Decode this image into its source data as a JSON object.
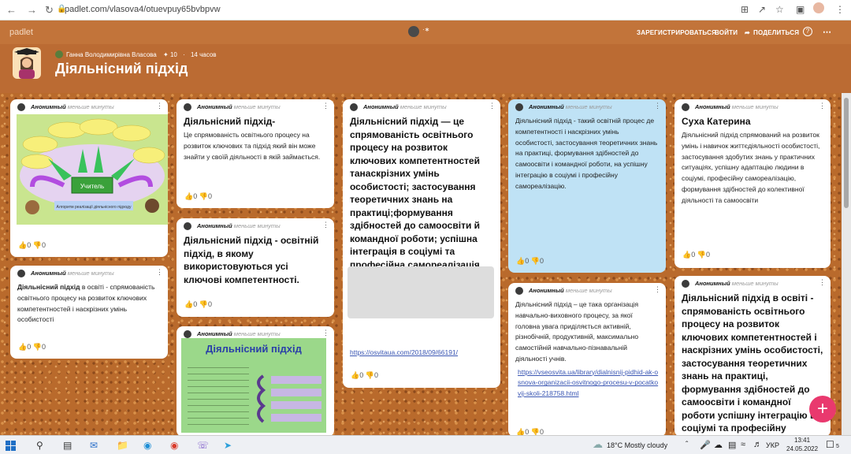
{
  "browser": {
    "url": "padlet.com/vlasova4/otuevpuy65bvbpvw"
  },
  "topbar": {
    "logo": "padlet",
    "register": "ЗАРЕГИСТРИРОВАТЬСЯ",
    "login": "ВОЙТИ",
    "share": "ПОДЕЛИТЬСЯ"
  },
  "header": {
    "author": "Ганна Володимирівна Власова",
    "likes": "10",
    "age": "14 часов",
    "title": "Діяльнісний підхід"
  },
  "card_meta": {
    "author": "Анонимный",
    "time": "меньше минуты",
    "zero": "0"
  },
  "cards": {
    "c1": {
      "img_title": "Учитель",
      "img_caption": "Алгоритм реалізації діяльнісного підходу"
    },
    "c2": {
      "bold": "Діяльнісний підхід",
      "text": " в освіті - спрямованість освітнього процесу на розвиток ключових компетентностей і наскрізних умінь особистості"
    },
    "c3": {
      "title": "Діяльнісний підхід-",
      "body": "Це спрямованість освітнього процесу на розвиток ключових та підхід який він може знайти у своїй діяльності в якій займається."
    },
    "c4": {
      "body": "Діяльнісний підхід - освітній підхід, в якому використовуються усі ключові компетентності."
    },
    "c5": {
      "img_title": "Діяльнісний підхід"
    },
    "c6": {
      "body": "Діяльнісний підхід — це спрямованість освітнього процесу на розвиток ключових компетентностей танаскрізних умінь особистості; застосування теоретичних знань на практиці;формування здібностей до самоосвіти й командної роботи; успішна інтеграція в соціумі та професійна самореалізація.",
      "link": "https://osvitaua.com/2018/09/66191/"
    },
    "c7": {
      "body": "Діяльнісний підхід - такий освітній процес де компетентності і наскрізних умінь особистості, застосування теоретичних знань на практиці, формування здібностей до самоосвіти і командної роботи, на успішну інтеграцію в соціумі і професійну самореалізацію."
    },
    "c8": {
      "body": "Діяльнісний підхід – це така організація навчально-виховного процесу, за якої головна увага приділяється активній, різнобічній, продуктивній, максимально самостійній навчально-пізнавальній діяльності учнів.",
      "link": "https://vseosvita.ua/library/dialnisnij-pidhid-ak-osnova-organizacii-osvitnogo-procesu-v-pocatkovij-skoli-218758.html"
    },
    "c9": {
      "title": "Суха Катерина",
      "body": "Діяльнісний підхід спрямований на розвиток умінь і навичок життєдіяльності особистості, застосування здобутих знань у практичних ситуаціях, успішну адаптацію людини в соціумі, професійну самореалізацію, формування здібностей до колективної діяльності та самоосвіти"
    },
    "c10": {
      "body": "Діяльнісний підхід в освіті - спрямованість освітнього процесу на розвиток ключових компетентностей і наскрізних умінь особистості, застосування теоретичних знань на практиці, формування здібностей до самоосвіти і командної роботи успішну інтеграцію в соціумі та професійну самореалізацію."
    }
  },
  "taskbar": {
    "weather": "18°C  Mostly cloudy",
    "lang": "УКР",
    "time": "13:41",
    "date": "24.05.2022",
    "notif": "5"
  },
  "colors": {
    "wall": "#b96a2c",
    "accent": "#e9396e",
    "blue_card": "#bfe2f5"
  }
}
